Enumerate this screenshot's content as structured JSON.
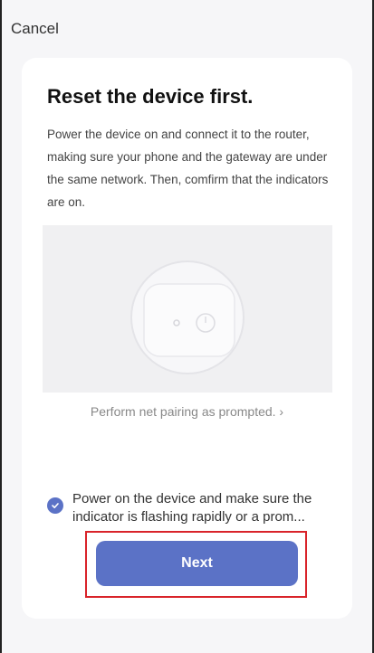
{
  "header": {
    "cancel_label": "Cancel"
  },
  "card": {
    "title": "Reset the device first.",
    "description": "Power the device on and connect it to the router, making sure your phone and the gateway are under the same network. Then, comfirm that the indicators are on.",
    "pairing_link": "Perform net pairing as prompted. ›",
    "confirm_text": "Power on the device and make sure the indicator is flashing rapidly or a prom...",
    "confirm_checked": true,
    "next_label": "Next"
  },
  "colors": {
    "accent": "#5b72c6",
    "highlight_border": "#d9232a",
    "background": "#f6f6f8"
  },
  "icons": {
    "illustration": "device-power-icon",
    "checkbox": "check-icon",
    "chevron": "chevron-right-icon"
  }
}
